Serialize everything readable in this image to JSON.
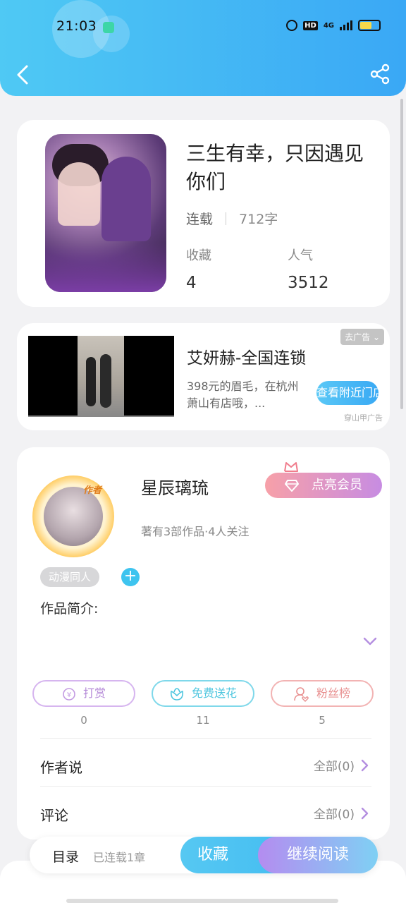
{
  "status_bar": {
    "time": "21:03",
    "network": "4G",
    "hd": "HD"
  },
  "book": {
    "title": "三生有幸，只因遇见你们",
    "status": "连载",
    "word_count": "712字",
    "favorites_label": "收藏",
    "favorites_value": "4",
    "popularity_label": "人气",
    "popularity_value": "3512"
  },
  "ad": {
    "title": "艾妍赫-全国连锁",
    "description": "398元的眉毛，在杭州萧山有店哦，...",
    "close_label": "去广告",
    "button_label": "查看附近门店",
    "source": "穿山甲广告"
  },
  "author": {
    "name": "星辰璃琉",
    "badge": "作者",
    "works": "著有3部作品·4人关注",
    "vip_button": "点亮会员",
    "tag": "动漫同人",
    "tag_add": "+",
    "intro_label": "作品简介:"
  },
  "actions": [
    {
      "label": "打赏",
      "count": "0",
      "color": "#c79ae6"
    },
    {
      "label": "免费送花",
      "count": "11",
      "color": "#5ad0e6"
    },
    {
      "label": "粉丝榜",
      "count": "5",
      "color": "#ef9a9a"
    }
  ],
  "rows": {
    "author_says": {
      "label": "作者说",
      "link": "全部(0)"
    },
    "comments": {
      "label": "评论",
      "link": "全部(0)"
    }
  },
  "bottom_bar": {
    "toc_label": "目录",
    "toc_count": "已连载1章",
    "collect_label": "收藏",
    "read_label": "继续阅读"
  },
  "colors": {
    "header": "#3aa8f5",
    "accent": "#4fc9f4"
  }
}
